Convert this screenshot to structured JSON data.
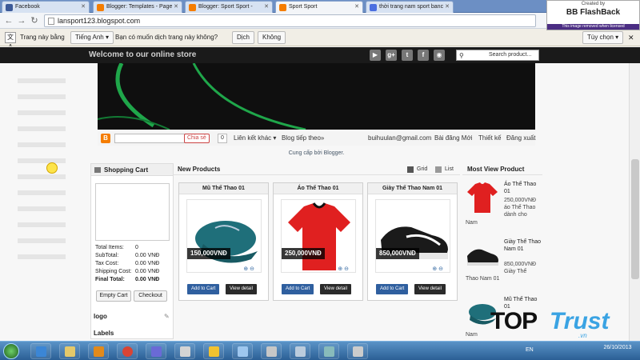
{
  "tabs": [
    {
      "label": "Facebook",
      "color": "#3b5998",
      "active": false
    },
    {
      "label": "Blogger: Templates - Page",
      "color": "#f57d00",
      "active": false
    },
    {
      "label": "Blogger: Sport Sport -",
      "color": "#f57d00",
      "active": false
    },
    {
      "label": "Sport Sport",
      "color": "#f57d00",
      "active": true
    },
    {
      "label": "thời trang nam sport banc",
      "color": "#4a6ee0",
      "active": false
    }
  ],
  "flashback": {
    "created_by": "Created by",
    "name": "BB FlashBack",
    "note": "This image removed when licensed"
  },
  "address": {
    "url": "lansport123.blogspot.com"
  },
  "translate": {
    "icon": "文A",
    "label1": "Trang này bằng",
    "lang": "Tiếng Anh",
    "question": "Bạn có muốn dịch trang này không?",
    "translate_btn": "Dịch",
    "no_btn": "Không",
    "options_btn": "Tùy chọn"
  },
  "store": {
    "welcome": "Welcome to our online store",
    "search_placeholder": "Search product...",
    "social": [
      "Tube",
      "g+",
      "t",
      "f",
      "rss"
    ]
  },
  "bloggerbar": {
    "share": "Chia sẻ",
    "count": "0",
    "more": "Liên kết khác",
    "next": "Blog tiếp theo»",
    "email": "buihuulan@gmail.com",
    "new_post": "Bài đăng Mới",
    "design": "Thiết kế",
    "logout": "Đăng xuất",
    "powered": "Cung cấp bởi Blogger."
  },
  "cart": {
    "title": "Shopping Cart",
    "rows": [
      {
        "label": "Total Items:",
        "value": "0"
      },
      {
        "label": "SubTotal:",
        "value": "0.00 VNĐ"
      },
      {
        "label": "Tax Cost:",
        "value": "0.00 VNĐ"
      },
      {
        "label": "Shipping Cost:",
        "value": "0.00 VNĐ"
      },
      {
        "label": "Final Total:",
        "value": "0.00 VNĐ"
      }
    ],
    "empty_btn": "Empty Cart",
    "checkout_btn": "Checkout",
    "logo": "logo",
    "labels": "Labels"
  },
  "new_products": {
    "title": "New Products",
    "grid": "Grid",
    "list": "List",
    "items": [
      {
        "name": "Mũ Thể Thao 01",
        "price": "150,000VNĐ",
        "add": "Add to Cart",
        "detail": "View detail"
      },
      {
        "name": "Áo Thể Thao 01",
        "price": "250,000VNĐ",
        "add": "Add to Cart",
        "detail": "View detail"
      },
      {
        "name": "Giày Thể Thao Nam 01",
        "price": "850,000VNĐ",
        "add": "Add to Cart",
        "detail": "View detail"
      }
    ]
  },
  "most_view": {
    "title": "Most View Product",
    "items": [
      {
        "name": "Áo Thể Thao 01",
        "price": "250,000VNĐ áo Thể Thao dành cho",
        "tail": "Nam"
      },
      {
        "name": "Giày Thể Thao Nam 01",
        "price": "850,000VNĐ Giày Thể",
        "tail": "Thao Nam 01"
      },
      {
        "name": "Mũ Thể Thao 01",
        "price": "",
        "tail": "Nam"
      }
    ]
  },
  "watermark": {
    "top": "TOP",
    "trust": "Trust",
    "vn": ".vn"
  },
  "taskbar": {
    "lang": "EN",
    "time": "26/10/2013"
  }
}
